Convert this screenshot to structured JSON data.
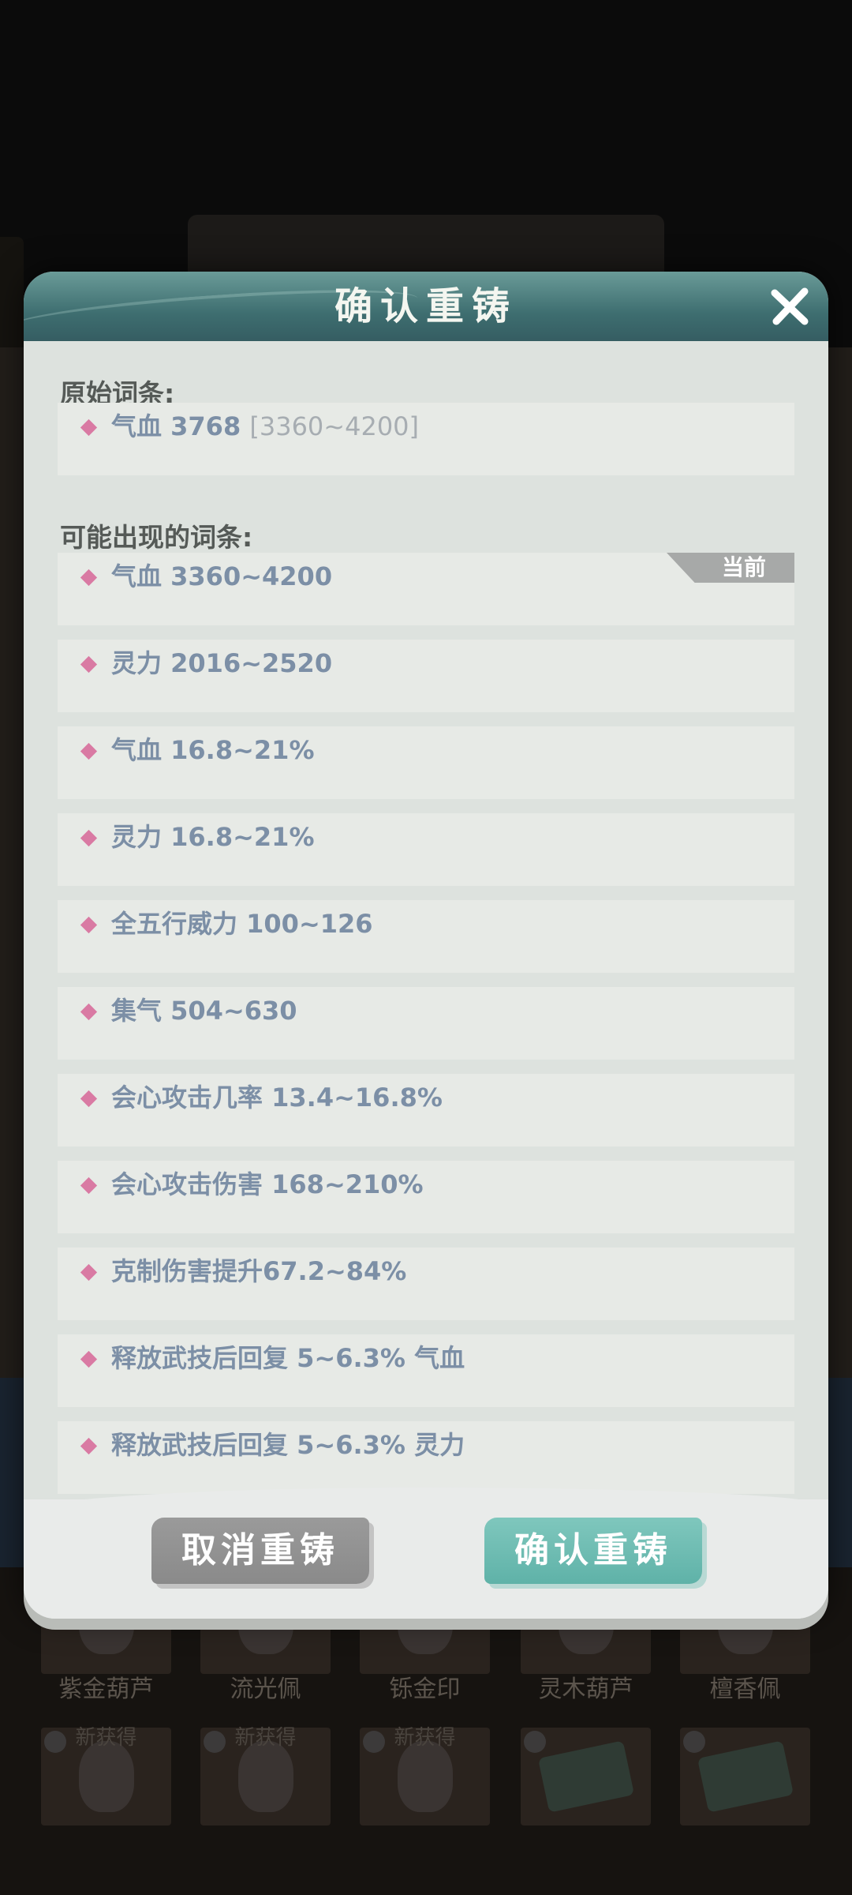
{
  "dialog": {
    "title": "确认重铸",
    "close_icon": "close-icon",
    "original_section_title": "原始词条:",
    "original_stat": {
      "name": "气血 3768",
      "range": "[3360~4200]"
    },
    "possible_section_title": "可能出现的词条:",
    "current_tag": "当前",
    "possible_stats": [
      "气血 3360~4200",
      "灵力 2016~2520",
      "气血 16.8~21%",
      "灵力 16.8~21%",
      "全五行威力 100~126",
      "集气 504~630",
      "会心攻击几率 13.4~16.8%",
      "会心攻击伤害 168~210%",
      "克制伤害提升67.2~84%",
      "释放武技后回复 5~6.3% 气血",
      "释放武技后回复 5~6.3% 灵力"
    ],
    "cancel_label": "取消重铸",
    "confirm_label": "确认重铸"
  },
  "background": {
    "item_names": [
      "紫金葫芦",
      "流光佩",
      "铄金印",
      "灵木葫芦",
      "檀香佩"
    ],
    "new_tags": [
      "新获得",
      "新获得",
      "新获得"
    ]
  },
  "colors": {
    "header": "#3e6e70",
    "diamond": "#d97aa3",
    "stat_text": "#7c8fa6",
    "confirm_button": "#5fb2a8",
    "cancel_button": "#8a8a8a"
  }
}
